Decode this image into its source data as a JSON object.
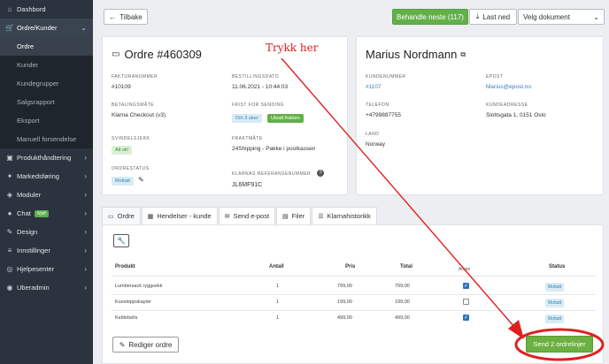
{
  "sidebar": {
    "items": [
      {
        "label": "Dashbord"
      },
      {
        "label": "Ordre/Kunder"
      },
      {
        "label": "Produkthåndtering"
      },
      {
        "label": "Markedsføring"
      },
      {
        "label": "Moduler"
      },
      {
        "label": "Chat",
        "badge": "Nytt!"
      },
      {
        "label": "Design"
      },
      {
        "label": "Innstillinger"
      },
      {
        "label": "Hjelpesenter"
      },
      {
        "label": "Uberadmin"
      }
    ],
    "sub": [
      "Ordre",
      "Kunder",
      "Kundegrupper",
      "Salgsrapport",
      "Eksport",
      "Manuell forsendelse"
    ]
  },
  "toolbar": {
    "back": "Tilbake",
    "next": "Behandle neste (117)",
    "download": "Last ned",
    "select_doc": "Velg dokument"
  },
  "order": {
    "title": "Ordre #460309",
    "invoice_label": "FAKTURANUMMER",
    "invoice": "#10109",
    "date_label": "BESTILLINGSDATO",
    "date": "11.06.2021 - 10:44:03",
    "payment_label": "BETALINGSMÅTE",
    "payment": "Klarna Checkout (v3)",
    "deadline_label": "FRIST FOR SENDING",
    "deadline_pill": "Om 3 uker",
    "deadline_pill2": "Utsatt frakten",
    "fraud_label": "SVINDELSJEKK",
    "fraud": "Alt ok!",
    "shipping_label": "FRAKTMÅTE",
    "shipping": "24Shipping - Pakke i postkassen",
    "status_label": "ORDRESTATUS",
    "status": "Mottatt",
    "klarna_label": "KLARNAS REFERANSENUMMER",
    "klarna": "JL6MF91C"
  },
  "customer": {
    "name": "Marius Nordmann",
    "custno_label": "KUNDENUMMER",
    "custno": "#1107",
    "email_label": "EPOST",
    "email": "Marius@epost.no",
    "phone_label": "TELEFON",
    "phone": "+4799887755",
    "address_label": "KUNDEADRESSE",
    "address": "Slottsgata 1, 0151 Oslo",
    "country_label": "LAND",
    "country": "Norway"
  },
  "tabs": [
    {
      "label": "Ordre"
    },
    {
      "label": "Hendelser - kunde"
    },
    {
      "label": "Send e-post"
    },
    {
      "label": "Filer"
    },
    {
      "label": "Klarnahistorikk"
    }
  ],
  "table": {
    "headers": {
      "product": "Produkt",
      "qty": "Antall",
      "price": "Pris",
      "total": "Total",
      "check": "Angre",
      "status": "Status"
    },
    "rows": [
      {
        "product": "Lumbersack ryggsekk",
        "qty": "1",
        "price": "799,00",
        "total": "799,00",
        "checked": true,
        "status": "Mottatt"
      },
      {
        "product": "Kuesteppskayter",
        "qty": "1",
        "price": "199,00",
        "total": "199,00",
        "checked": false,
        "status": "Mottatt"
      },
      {
        "product": "Kettlebells",
        "qty": "1",
        "price": "499,00",
        "total": "499,00",
        "checked": true,
        "status": "Mottatt"
      }
    ]
  },
  "actions": {
    "edit": "Rediger ordre",
    "send": "Send 2 ordrelinjer"
  },
  "annotation": {
    "text": "Trykk her",
    "color": "#e02020"
  }
}
